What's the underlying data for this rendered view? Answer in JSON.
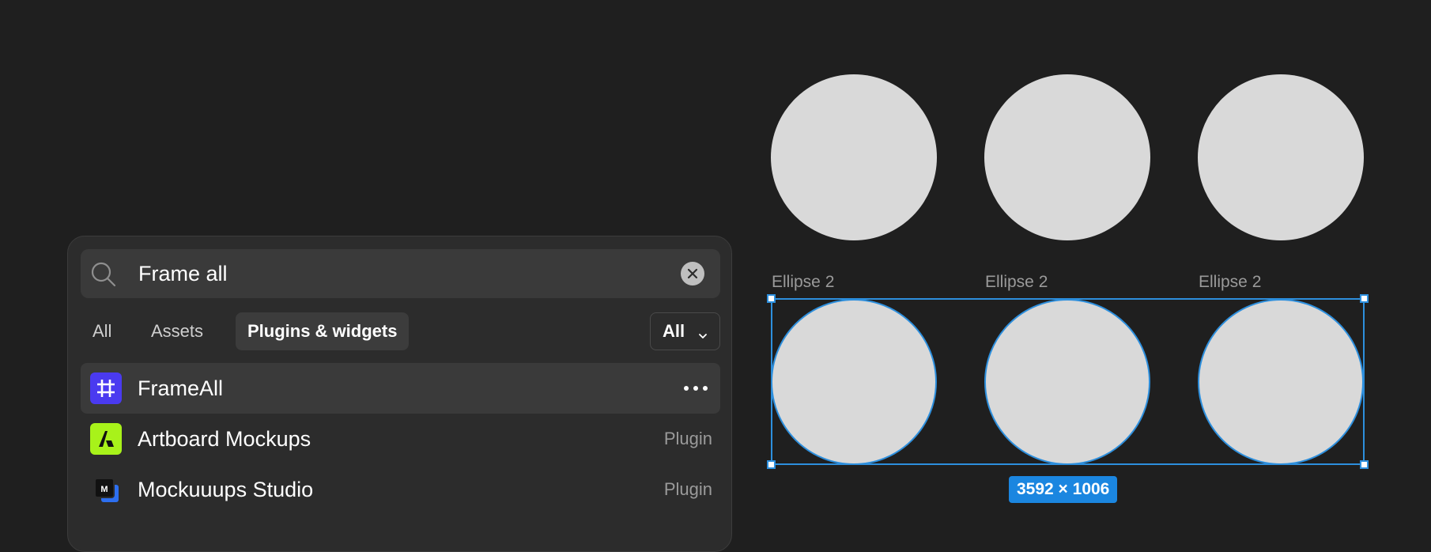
{
  "canvas": {
    "ellipse_label": "Ellipse 2",
    "dimensions": "3592 × 1006",
    "accent_color": "#2d8fdd",
    "shape_fill": "#d9d9d9"
  },
  "quick_actions": {
    "search": {
      "value": "Frame all",
      "icon": "search-icon",
      "clear_icon": "clear-icon"
    },
    "tabs": [
      {
        "label": "All",
        "active": false
      },
      {
        "label": "Assets",
        "active": false
      },
      {
        "label": "Plugins & widgets",
        "active": true
      }
    ],
    "filter": {
      "selected": "All",
      "icon": "chevron-down-icon"
    },
    "results": [
      {
        "name": "FrameAll",
        "type": "",
        "icon": "frameall-logo",
        "highlighted": true,
        "more_icon": "more-icon"
      },
      {
        "name": "Artboard Mockups",
        "type": "Plugin",
        "icon": "artboard-mockups-logo",
        "highlighted": false
      },
      {
        "name": "Mockuuups Studio",
        "type": "Plugin",
        "icon": "mockuuups-studio-logo",
        "highlighted": false
      }
    ]
  }
}
